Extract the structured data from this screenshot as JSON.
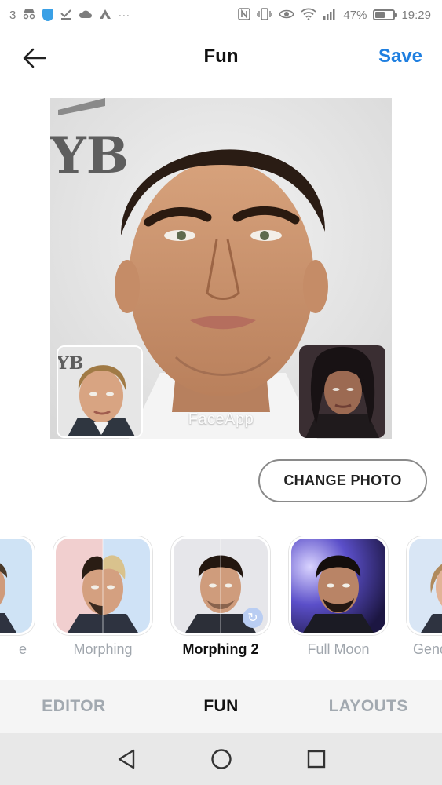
{
  "status_bar": {
    "left_number": "3",
    "icons_left": [
      "incognito-icon",
      "shield-icon",
      "check-icon",
      "cloud-icon",
      "a-icon",
      "more-icon"
    ],
    "more": "···",
    "icons_right": [
      "nfc-icon",
      "vibrate-icon",
      "eye-icon",
      "wifi-icon",
      "signal-icon"
    ],
    "battery_percent": "47%",
    "battery_level": 0.47,
    "time": "19:29"
  },
  "header": {
    "title": "Fun",
    "save_label": "Save",
    "accent_color": "#1f7fe0"
  },
  "photo": {
    "watermark": "FaceApp",
    "background_text": "YB"
  },
  "change_photo_label": "CHANGE PHOTO",
  "filters": [
    {
      "label": "e",
      "active": false
    },
    {
      "label": "Morphing",
      "active": false
    },
    {
      "label": "Morphing 2",
      "active": true
    },
    {
      "label": "Full Moon",
      "active": false
    },
    {
      "label": "Gend",
      "active": false
    }
  ],
  "tabs": [
    {
      "label": "EDITOR",
      "active": false
    },
    {
      "label": "FUN",
      "active": true
    },
    {
      "label": "LAYOUTS",
      "active": false
    }
  ],
  "nav": {
    "icons": [
      "back-triangle-icon",
      "home-circle-icon",
      "recents-square-icon"
    ]
  }
}
